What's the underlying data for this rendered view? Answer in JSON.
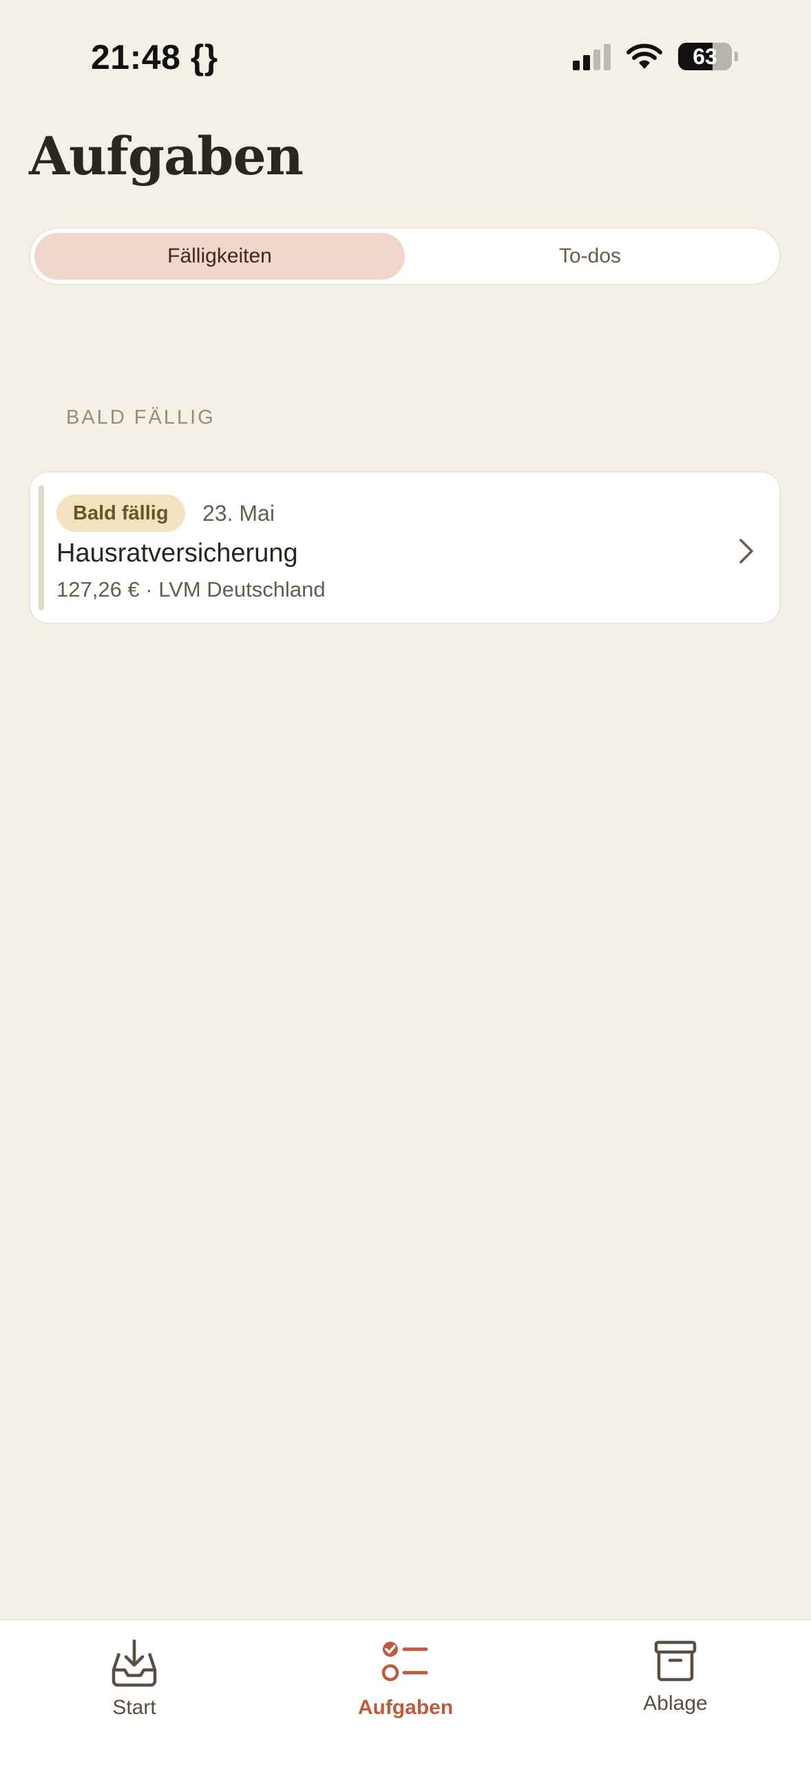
{
  "status_bar": {
    "time": "21:48",
    "dev_indicator": "{}",
    "battery_percent": "63",
    "signal_bars": 4,
    "signal_active_bars": 2,
    "icons": [
      "cellular-signal-icon",
      "wifi-icon",
      "battery-icon"
    ]
  },
  "header": {
    "title": "Aufgaben"
  },
  "segmented_control": {
    "selected_index": 0,
    "segments": [
      {
        "label": "Fälligkeiten"
      },
      {
        "label": "To-dos"
      }
    ]
  },
  "sections": [
    {
      "title": "BALD FÄLLIG",
      "items": [
        {
          "badge": "Bald fällig",
          "date": "23. Mai",
          "title": "Hausratversicherung",
          "subtitle": "127,26 € · LVM Deutschland",
          "icon": "chevron-right-icon"
        }
      ]
    }
  ],
  "tab_bar": {
    "active_index": 1,
    "tabs": [
      {
        "label": "Start",
        "icon": "inbox-download-icon"
      },
      {
        "label": "Aufgaben",
        "icon": "checklist-icon"
      },
      {
        "label": "Ablage",
        "icon": "archive-box-icon"
      }
    ]
  },
  "colors": {
    "background": "#f5f0e6",
    "accent": "#bf5a3c",
    "segment_active": "#f0d6cb",
    "badge_background": "#f3e2c0",
    "card_background": "#ffffff"
  }
}
